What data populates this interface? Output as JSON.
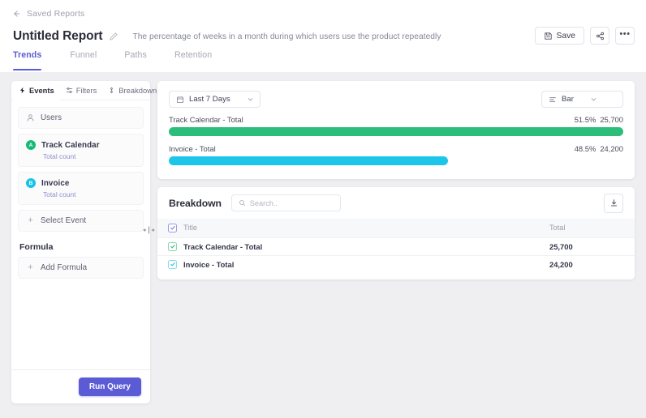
{
  "header": {
    "back_label": "Saved Reports",
    "back_icon": "arrow-left-icon",
    "title": "Untitled Report",
    "edit_icon": "pencil-edit-icon",
    "description": "The percentage of weeks in a month during which users use the product repeatedly",
    "save_label": "Save",
    "save_icon": "floppy-save-icon",
    "share_icon": "share-icon",
    "more_label": "•••"
  },
  "tabs": [
    {
      "label": "Trends",
      "active": true
    },
    {
      "label": "Funnel",
      "active": false
    },
    {
      "label": "Paths",
      "active": false
    },
    {
      "label": "Retention",
      "active": false
    }
  ],
  "query_panel": {
    "tabs": [
      {
        "label": "Events",
        "icon": "lightning-bolt-icon",
        "active": true
      },
      {
        "label": "Filters",
        "icon": "filter-sliders-icon",
        "active": false
      },
      {
        "label": "Breakdown",
        "icon": "breakdown-icon",
        "active": false
      }
    ],
    "users_row": {
      "label": "Users",
      "icon": "person-icon"
    },
    "events": [
      {
        "badge": "A",
        "badge_color": "#17b978",
        "name": "Track Calendar",
        "sub": "Total count"
      },
      {
        "badge": "B",
        "badge_color": "#17c4e8",
        "name": "Invoice",
        "sub": "Total count"
      }
    ],
    "select_event_label": "Select Event",
    "formula_heading": "Formula",
    "add_formula_label": "Add Formula",
    "run_query_label": "Run Query",
    "resize_handle_icon": "resize-horizontal-icon"
  },
  "chart_panel": {
    "date_range": {
      "label": "Last 7 Days",
      "icon": "calendar-icon",
      "chevron": "chevron-down-icon"
    },
    "chart_type": {
      "label": "Bar",
      "icon": "bar-list-icon",
      "chevron": "chevron-down-icon"
    }
  },
  "chart_data": {
    "type": "bar",
    "orientation": "horizontal",
    "title": "",
    "categories": [
      "Track Calendar - Total",
      "Invoice - Total"
    ],
    "values": [
      25700,
      24200
    ],
    "value_labels": [
      "25,700",
      "24,200"
    ],
    "percent_labels": [
      "51.5%",
      "48.5%"
    ],
    "percents": [
      51.5,
      48.5
    ],
    "colors": [
      "#2cbd7b",
      "#1dc6e9"
    ],
    "bar_widths_pct": [
      100,
      61.5
    ],
    "xlabel": "",
    "ylabel": "",
    "grid": false,
    "legend": "none"
  },
  "breakdown": {
    "title": "Breakdown",
    "search": {
      "placeholder": "Search..",
      "value": "",
      "icon": "search-icon"
    },
    "download_icon": "download-icon",
    "columns": [
      "Title",
      "Total"
    ],
    "header_checkbox_color": "#7b7ce0",
    "rows": [
      {
        "checked": true,
        "color": "#3fbf84",
        "title": "Track Calendar - Total",
        "total": "25,700"
      },
      {
        "checked": true,
        "color": "#2ac5e8",
        "title": "Invoice - Total",
        "total": "24,200"
      }
    ]
  },
  "colors": {
    "accent": "#5b5bd6",
    "green": "#2cbd7b",
    "cyan": "#1dc6e9",
    "bg": "#efeff1"
  }
}
